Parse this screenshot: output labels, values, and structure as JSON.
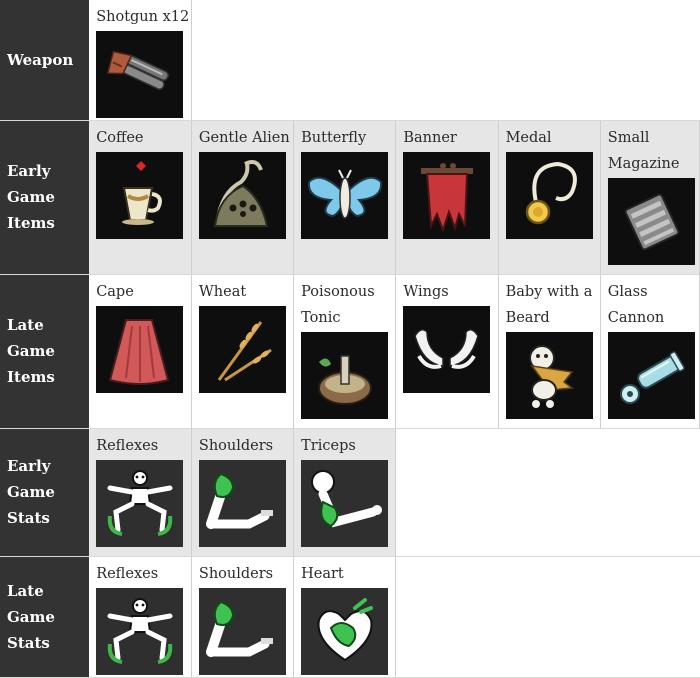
{
  "rows": [
    {
      "header": "Weapon",
      "items": [
        {
          "name": "Shotgun x12",
          "icon": "shotgun-icon"
        }
      ]
    },
    {
      "header": "Early Game Items",
      "items": [
        {
          "name": "Coffee",
          "icon": "coffee-icon"
        },
        {
          "name": "Gentle Alien",
          "icon": "gentle-alien-icon"
        },
        {
          "name": "Butterfly",
          "icon": "butterfly-icon"
        },
        {
          "name": "Banner",
          "icon": "banner-icon"
        },
        {
          "name": "Medal",
          "icon": "medal-icon"
        },
        {
          "name": "Small Magazine",
          "icon": "small-magazine-icon"
        }
      ]
    },
    {
      "header": "Late Game Items",
      "items": [
        {
          "name": "Cape",
          "icon": "cape-icon"
        },
        {
          "name": "Wheat",
          "icon": "wheat-icon"
        },
        {
          "name": "Poisonous Tonic",
          "icon": "poisonous-tonic-icon"
        },
        {
          "name": "Wings",
          "icon": "wings-icon"
        },
        {
          "name": "Baby with a Beard",
          "icon": "baby-with-a-beard-icon"
        },
        {
          "name": "Glass Cannon",
          "icon": "glass-cannon-icon"
        }
      ]
    },
    {
      "header": "Early Game Stats",
      "items": [
        {
          "name": "Reflexes",
          "icon": "reflexes-icon"
        },
        {
          "name": "Shoulders",
          "icon": "shoulders-icon"
        },
        {
          "name": "Triceps",
          "icon": "triceps-icon"
        }
      ]
    },
    {
      "header": "Late Game Stats",
      "items": [
        {
          "name": "Reflexes",
          "icon": "reflexes-icon"
        },
        {
          "name": "Shoulders",
          "icon": "shoulders-icon"
        },
        {
          "name": "Heart",
          "icon": "heart-icon"
        }
      ]
    }
  ]
}
